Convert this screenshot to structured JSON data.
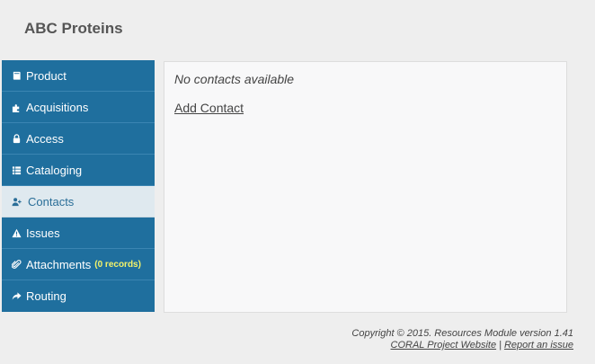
{
  "header": {
    "title": "ABC Proteins"
  },
  "sidebar": {
    "items": [
      {
        "label": "Product",
        "icon": "book-icon"
      },
      {
        "label": "Acquisitions",
        "icon": "puzzle-icon"
      },
      {
        "label": "Access",
        "icon": "lock-icon"
      },
      {
        "label": "Cataloging",
        "icon": "list-icon"
      },
      {
        "label": "Contacts",
        "icon": "user-add-icon",
        "active": true
      },
      {
        "label": "Issues",
        "icon": "warning-icon"
      },
      {
        "label": "Attachments",
        "icon": "paperclip-icon",
        "badge": "(0 records)"
      },
      {
        "label": "Routing",
        "icon": "share-arrow-icon"
      }
    ]
  },
  "main": {
    "empty_text": "No contacts available",
    "add_contact_label": "Add Contact"
  },
  "footer": {
    "copyright": "Copyright © 2015. Resources Module version 1.41",
    "website_link": "CORAL Project Website",
    "separator": "|",
    "report_link": "Report an issue"
  },
  "colors": {
    "sidebar_bg": "#1f6f9e",
    "sidebar_active_bg": "#dfe9ef",
    "badge": "#f3f36a",
    "page_bg": "#eeeeee"
  }
}
